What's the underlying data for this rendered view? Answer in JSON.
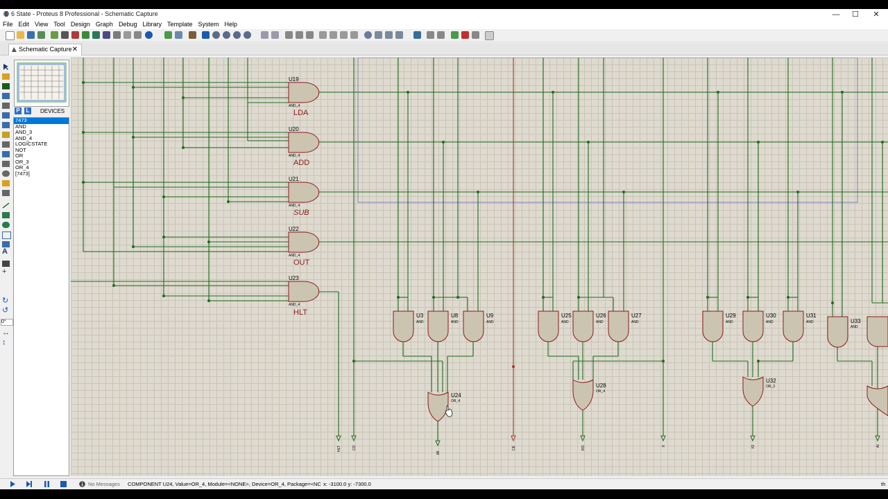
{
  "window": {
    "title": "6 State - Proteus 8 Professional - Schematic Capture"
  },
  "window_controls": {
    "minimize": "—",
    "maximize": "☐",
    "close": "✕"
  },
  "menu": [
    "File",
    "Edit",
    "View",
    "Tool",
    "Design",
    "Graph",
    "Debug",
    "Library",
    "Template",
    "System",
    "Help"
  ],
  "tab": {
    "label": "Schematic Capture",
    "close": "✕"
  },
  "devices": {
    "p_button": "P",
    "l_button": "L",
    "header": "DEVICES",
    "items": [
      "7473",
      "AND",
      "AND_3",
      "AND_4",
      "LOGICSTATE",
      "NOT",
      "OR",
      "OR_3",
      "OR_4",
      "[7473]"
    ],
    "selected_index": 0
  },
  "rotation": "0°",
  "schematic": {
    "decoders": [
      {
        "ref": "U19",
        "type": "AND_4",
        "label": "LDA",
        "label_style": "normal"
      },
      {
        "ref": "U20",
        "type": "AND_4",
        "label": "ADD",
        "label_style": "normal"
      },
      {
        "ref": "U21",
        "type": "AND_4",
        "label": "SUB",
        "label_style": "italic"
      },
      {
        "ref": "U22",
        "type": "AND_4",
        "label": "OUT",
        "label_style": "normal"
      },
      {
        "ref": "U23",
        "type": "AND_4",
        "label": "HLT",
        "label_style": "normal"
      }
    ],
    "and_gates": [
      {
        "ref": "U3",
        "type": "AND"
      },
      {
        "ref": "U8",
        "type": "AND"
      },
      {
        "ref": "U9",
        "type": "AND"
      },
      {
        "ref": "U25",
        "type": "AND"
      },
      {
        "ref": "U26",
        "type": "AND"
      },
      {
        "ref": "U27",
        "type": "AND"
      },
      {
        "ref": "U29",
        "type": "AND"
      },
      {
        "ref": "U30",
        "type": "AND"
      },
      {
        "ref": "U31",
        "type": "AND"
      },
      {
        "ref": "U33",
        "type": "AND"
      }
    ],
    "or_gates": [
      {
        "ref": "U24",
        "type": "OR_4"
      },
      {
        "ref": "U28",
        "type": "OR_4"
      },
      {
        "ref": "U32",
        "type": "OR_3"
      }
    ],
    "terminals": [
      "HLT",
      "CO",
      "MI",
      "CE",
      "RO",
      "II",
      "IO",
      "AI"
    ]
  },
  "status": {
    "messages": "No Messages",
    "component": "COMPONENT U24, Value=OR_4, Module=<NONE>, Device=OR_4, Package=<NC",
    "coords": "x:    -3100.0  y:    -7300.0",
    "right": "th"
  },
  "colors": {
    "wire": "#1f6b1f",
    "component_fill": "#cbc4b0",
    "component_stroke": "#8b1a1a",
    "grid_bg": "#dedad0",
    "label_red": "#8b1a1a",
    "selection_blue": "#2a6fc9"
  }
}
